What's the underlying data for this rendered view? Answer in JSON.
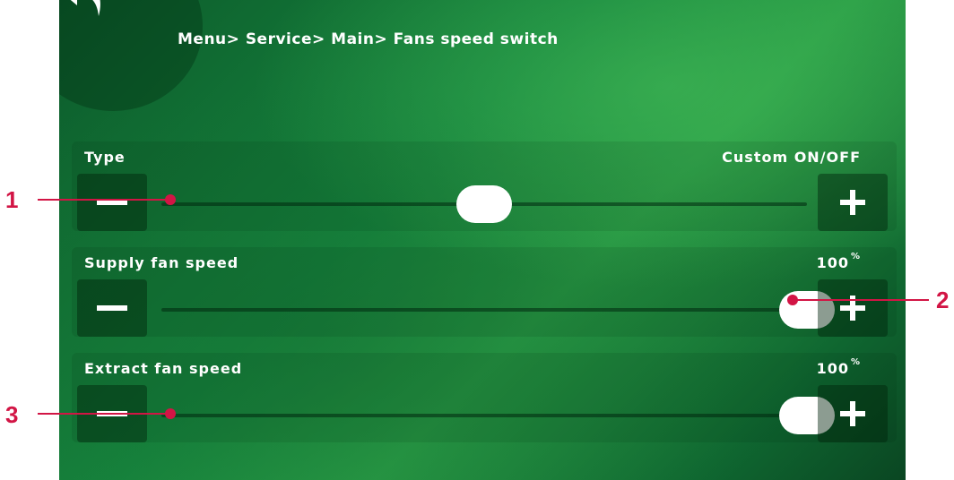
{
  "header": {
    "breadcrumb": "Menu> Service> Main> Fans speed switch",
    "back_icon": "back-arrow-icon"
  },
  "rows": [
    {
      "label": "Type",
      "value": "Custom ON/OFF",
      "unit": "",
      "level": 0.5
    },
    {
      "label": "Supply fan speed",
      "value": "100",
      "unit": "%",
      "level": 1.0
    },
    {
      "label": "Extract fan speed",
      "value": "100",
      "unit": "%",
      "level": 1.0
    }
  ],
  "controls": {
    "minus_icon": "minus-icon",
    "plus_icon": "plus-icon"
  },
  "callouts": [
    "1",
    "2",
    "3"
  ],
  "colors": {
    "callout": "#d21545",
    "background": "#16843d",
    "thumb": "#ffffff"
  }
}
